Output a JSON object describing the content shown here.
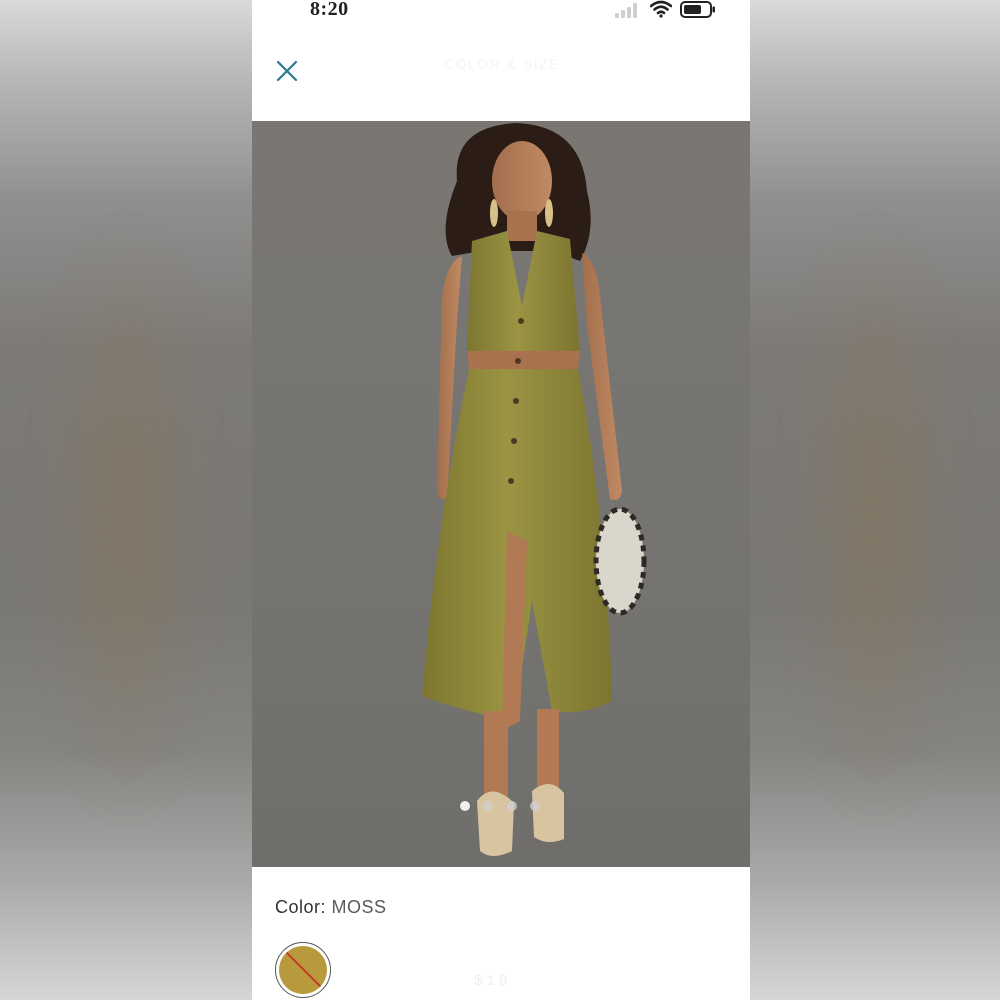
{
  "status_bar": {
    "time": "8:20",
    "signal_icon": "cellular-signal-icon",
    "wifi_icon": "wifi-icon",
    "battery_icon": "battery-icon"
  },
  "header": {
    "close_icon": "close-icon",
    "title": "COLOR & SIZE"
  },
  "product_image": {
    "carousel_dots": 4,
    "active_dot": 1
  },
  "color": {
    "label": "Color:",
    "value": "MOSS",
    "swatch_color": "#b89a3c"
  },
  "footer": {
    "price_ghost": "$ 1 8"
  },
  "colors": {
    "accent": "#2a7b8c",
    "dress": "#8f8a3a"
  }
}
